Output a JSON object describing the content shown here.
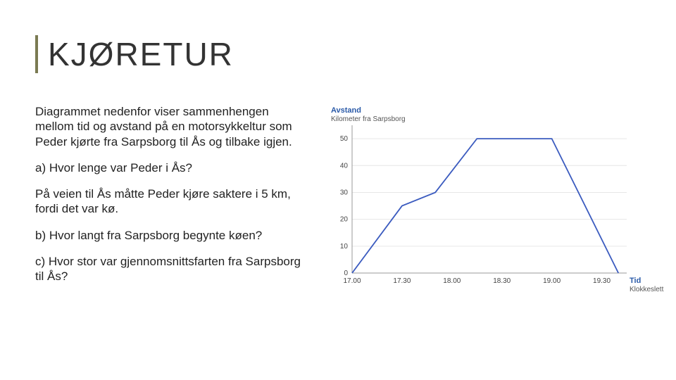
{
  "title": "KJØRETUR",
  "paragraphs": [
    "Diagrammet nedenfor viser sammenhengen mellom tid og avstand på en motorsykkeltur som Peder kjørte fra Sarpsborg til Ås og tilbake igjen.",
    "a) Hvor lenge var Peder i Ås?",
    "På veien til Ås måtte Peder kjøre saktere i 5 km, fordi det var kø.",
    "b) Hvor langt fra Sarpsborg begynte køen?",
    "c) Hvor stor var gjennomsnittsfarten fra Sarpsborg til Ås?"
  ],
  "chart_data": {
    "type": "line",
    "title": "",
    "y_title": "Avstand",
    "y_subtitle": "Kilometer fra Sarpsborg",
    "x_title": "Tid",
    "x_subtitle": "Klokkeslett",
    "x_ticks": [
      "17.00",
      "17.30",
      "18.00",
      "18.30",
      "19.00",
      "19.30"
    ],
    "y_ticks": [
      0,
      10,
      20,
      30,
      40,
      50
    ],
    "ylim": [
      0,
      55
    ],
    "xlim_minutes": [
      1020,
      1185
    ],
    "series": [
      {
        "name": "distance",
        "points": [
          {
            "t": "17.00",
            "minutes": 1020,
            "km": 0
          },
          {
            "t": "17.30",
            "minutes": 1050,
            "km": 25
          },
          {
            "t": "17.50",
            "minutes": 1070,
            "km": 30
          },
          {
            "t": "18.15",
            "minutes": 1095,
            "km": 50
          },
          {
            "t": "19.00",
            "minutes": 1140,
            "km": 50
          },
          {
            "t": "19.40",
            "minutes": 1180,
            "km": 0
          }
        ]
      }
    ]
  }
}
